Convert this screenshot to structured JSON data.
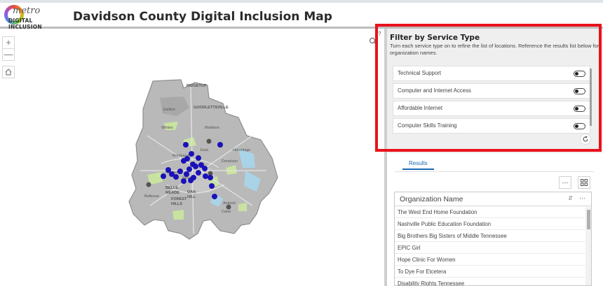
{
  "header": {
    "logo_line1": "metro",
    "logo_line2": "DIGITAL INCLUSION",
    "title": "Davidson County Digital Inclusion Map"
  },
  "map": {
    "zoom_in": "+",
    "zoom_out": "—",
    "home_icon": "home-icon",
    "search_icon": "search-icon",
    "place_labels": [
      "RIDGETOP",
      "GOODLETTSVILLE",
      "Joelton",
      "Whites",
      "Madison",
      "Bordeaux",
      "East",
      "Nashville",
      "Donelson",
      "BELLE MEADE",
      "OAK HILL",
      "FOREST HILLS",
      "Antioch",
      "Cane",
      "Bellevue",
      "Hermitage",
      "West"
    ],
    "colors": {
      "county_fill": "#b9b9b9",
      "park_fill": "#c8e3a0",
      "water_fill": "#a9d3e6",
      "marker": "#1a12b8"
    }
  },
  "filter": {
    "title": "Filter by Service Type",
    "description": "Turn each service type on to refine the list of locations. Reference the results list below for organization names.",
    "help_icon": "?",
    "items": [
      {
        "label": "Technical Support",
        "on": false
      },
      {
        "label": "Computer and Internet Access",
        "on": false
      },
      {
        "label": "Affordable Internet",
        "on": false
      },
      {
        "label": "Computer Skills Training",
        "on": false
      }
    ],
    "reset_icon": "reset-icon"
  },
  "results": {
    "tab_label": "Results",
    "more_icon": "⋯",
    "grid_icon": "grid-icon",
    "column_header": "Organization Name",
    "rows": [
      "The West End Home Foundation",
      "Nashville Public Education Foundation",
      "Big Brothers Big Sisters of Middle Tennessee",
      "EPIC Girl",
      "Hope Clinic For Women",
      "To Dye For Etcetera",
      "Disability Rights Tennessee"
    ]
  },
  "highlight": {
    "color": "#e8121b"
  }
}
